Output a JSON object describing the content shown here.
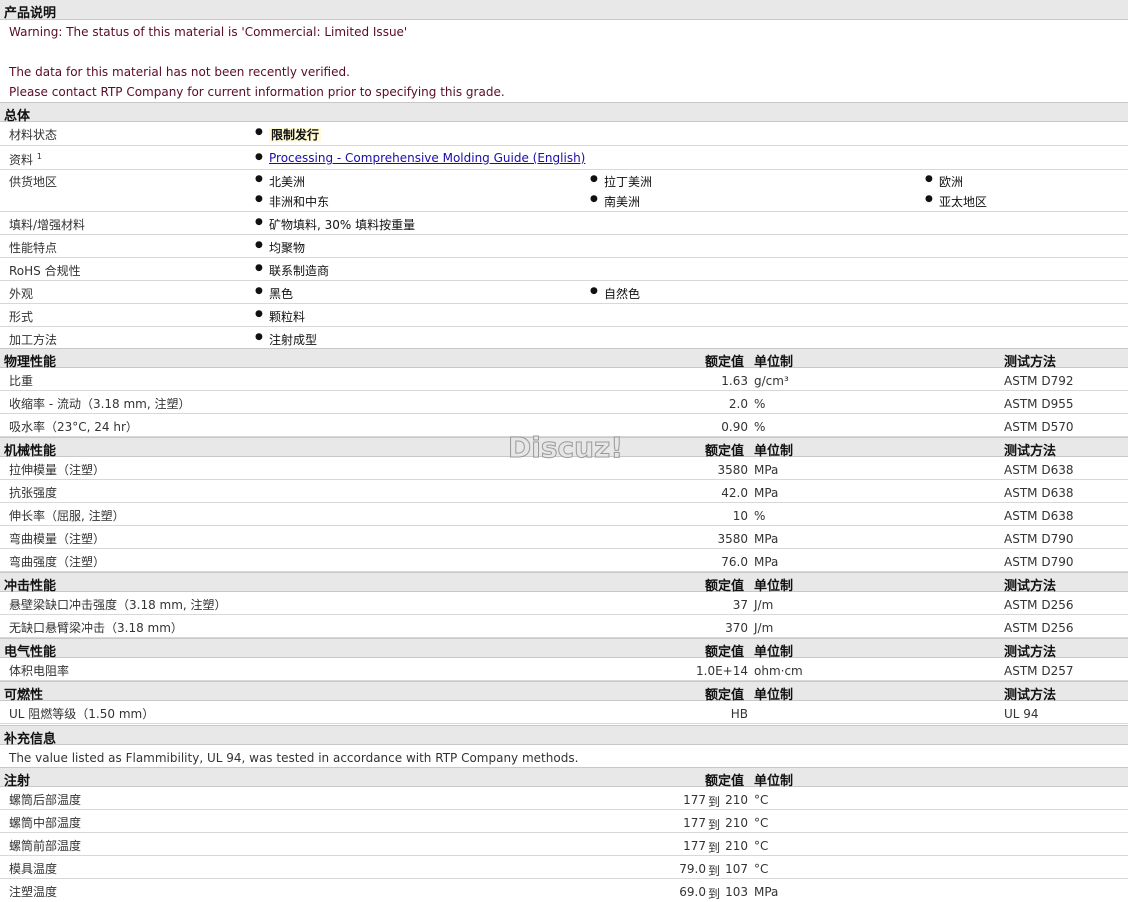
{
  "intro": {
    "title": "产品说明",
    "warning": "Warning: The status of this material is 'Commercial: Limited Issue'",
    "line2": "The data for this material has not been recently verified.",
    "line3": "Please contact RTP Company for current information prior to specifying this grade."
  },
  "general": {
    "title": "总体",
    "status_label": "材料状态",
    "status_value": "限制发行",
    "docs_label": "资料",
    "docs_sup": "1",
    "docs_link": "Processing - Comprehensive Molding Guide (English)",
    "supply_label": "供货地区",
    "supply": [
      "北美洲",
      "拉丁美洲",
      "欧洲",
      "非洲和中东",
      "南美洲",
      "亚太地区"
    ],
    "filler_label": "填料/增强材料",
    "filler_value": "矿物填料, 30% 填料按重量",
    "feature_label": "性能特点",
    "feature_value": "均聚物",
    "rohs_label": "RoHS 合规性",
    "rohs_value": "联系制造商",
    "appearance_label": "外观",
    "appearance": [
      "黑色",
      "自然色"
    ],
    "form_label": "形式",
    "form_value": "颗粒料",
    "process_label": "加工方法",
    "process_value": "注射成型"
  },
  "headers": {
    "value": "额定值",
    "unit": "单位制",
    "method": "测试方法"
  },
  "physical": {
    "title": "物理性能",
    "rows": [
      {
        "label": "比重",
        "value": "1.63",
        "unit": "g/cm³",
        "method": "ASTM D792"
      },
      {
        "label": "收缩率  - 流动（3.18 mm, 注塑）",
        "value": "2.0",
        "unit": "%",
        "method": "ASTM D955"
      },
      {
        "label": "吸水率（23°C, 24 hr）",
        "value": "0.90",
        "unit": "%",
        "method": "ASTM D570"
      }
    ]
  },
  "mechanical": {
    "title": "机械性能",
    "rows": [
      {
        "label": "拉伸模量（注塑）",
        "value": "3580",
        "unit": "MPa",
        "method": "ASTM D638"
      },
      {
        "label": "抗张强度",
        "value": "42.0",
        "unit": "MPa",
        "method": "ASTM D638"
      },
      {
        "label": "伸长率（屈服, 注塑）",
        "value": "10",
        "unit": "%",
        "method": "ASTM D638"
      },
      {
        "label": "弯曲模量（注塑）",
        "value": "3580",
        "unit": "MPa",
        "method": "ASTM D790"
      },
      {
        "label": "弯曲强度（注塑）",
        "value": "76.0",
        "unit": "MPa",
        "method": "ASTM D790"
      }
    ]
  },
  "impact": {
    "title": "冲击性能",
    "rows": [
      {
        "label": "悬壁梁缺口冲击强度（3.18 mm, 注塑）",
        "value": "37",
        "unit": "J/m",
        "method": "ASTM D256"
      },
      {
        "label": "无缺口悬臂梁冲击（3.18 mm）",
        "value": "370",
        "unit": "J/m",
        "method": "ASTM D256"
      }
    ]
  },
  "electrical": {
    "title": "电气性能",
    "rows": [
      {
        "label": "体积电阻率",
        "value": "1.0E+14",
        "unit": "ohm·cm",
        "method": "ASTM D257"
      }
    ]
  },
  "flammability": {
    "title": "可燃性",
    "rows": [
      {
        "label": "UL 阻燃等级（1.50 mm）",
        "value": "HB",
        "unit": "",
        "method": "UL 94"
      }
    ]
  },
  "supplement": {
    "title": "补充信息",
    "text": "The value listed as Flammibility, UL 94, was tested in accordance with RTP Company methods."
  },
  "injection": {
    "title": "注射",
    "to": "到",
    "rows": [
      {
        "label": "螺筒后部温度",
        "from": "177",
        "to": "210",
        "unit": "°C"
      },
      {
        "label": "螺筒中部温度",
        "from": "177",
        "to": "210",
        "unit": "°C"
      },
      {
        "label": "螺筒前部温度",
        "from": "177",
        "to": "210",
        "unit": "°C"
      },
      {
        "label": "模具温度",
        "from": "79.0",
        "to": "107",
        "unit": "°C"
      },
      {
        "label": "注塑温度",
        "from": "69.0",
        "to": "103",
        "unit": "MPa"
      }
    ]
  },
  "watermark": "Discuz!"
}
